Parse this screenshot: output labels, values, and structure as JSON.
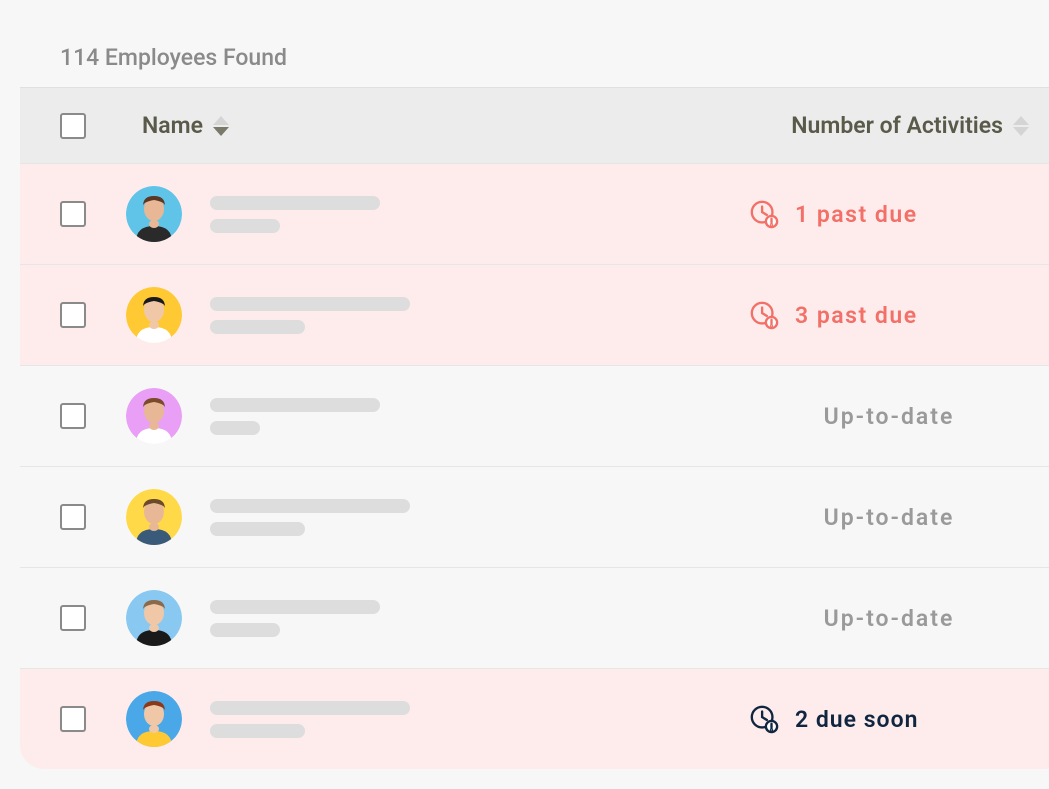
{
  "summary": "114 Employees Found",
  "columns": {
    "name": "Name",
    "activities": "Number of Activities"
  },
  "rows": [
    {
      "avatar_bg": "#5fc4e8",
      "avatar_skin": "#e8b896",
      "avatar_hair": "#5a3825",
      "avatar_shirt": "#2a2a2a",
      "line1_width": "long",
      "line2_width": "short",
      "status_type": "past-due",
      "status_text": "1 past due",
      "row_class": "alert"
    },
    {
      "avatar_bg": "#ffc934",
      "avatar_skin": "#f0c8a8",
      "avatar_hair": "#1a1a1a",
      "avatar_shirt": "#ffffff",
      "line1_width": "medium",
      "line2_width": "shorter",
      "status_type": "past-due",
      "status_text": "3 past due",
      "row_class": "alert"
    },
    {
      "avatar_bg": "#e89ff5",
      "avatar_skin": "#e8b896",
      "avatar_hair": "#7a4a2a",
      "avatar_shirt": "#ffffff",
      "line1_width": "long",
      "line2_width": "shortest",
      "status_type": "uptodate",
      "status_text": "Up-to-date",
      "row_class": ""
    },
    {
      "avatar_bg": "#ffd948",
      "avatar_skin": "#e8b896",
      "avatar_hair": "#6a4a2a",
      "avatar_shirt": "#3a5a7a",
      "line1_width": "medium",
      "line2_width": "shorter",
      "status_type": "uptodate",
      "status_text": "Up-to-date",
      "row_class": ""
    },
    {
      "avatar_bg": "#89c8f0",
      "avatar_skin": "#f0c8a8",
      "avatar_hair": "#8a6a4a",
      "avatar_shirt": "#1a1a1a",
      "line1_width": "long",
      "line2_width": "short",
      "status_type": "uptodate",
      "status_text": "Up-to-date",
      "row_class": ""
    },
    {
      "avatar_bg": "#4aa8e8",
      "avatar_skin": "#f0c8a8",
      "avatar_hair": "#8a3a1a",
      "avatar_shirt": "#ffc934",
      "line1_width": "medium",
      "line2_width": "shorter",
      "status_type": "due-soon",
      "status_text": "2 due soon",
      "row_class": "warn"
    }
  ]
}
